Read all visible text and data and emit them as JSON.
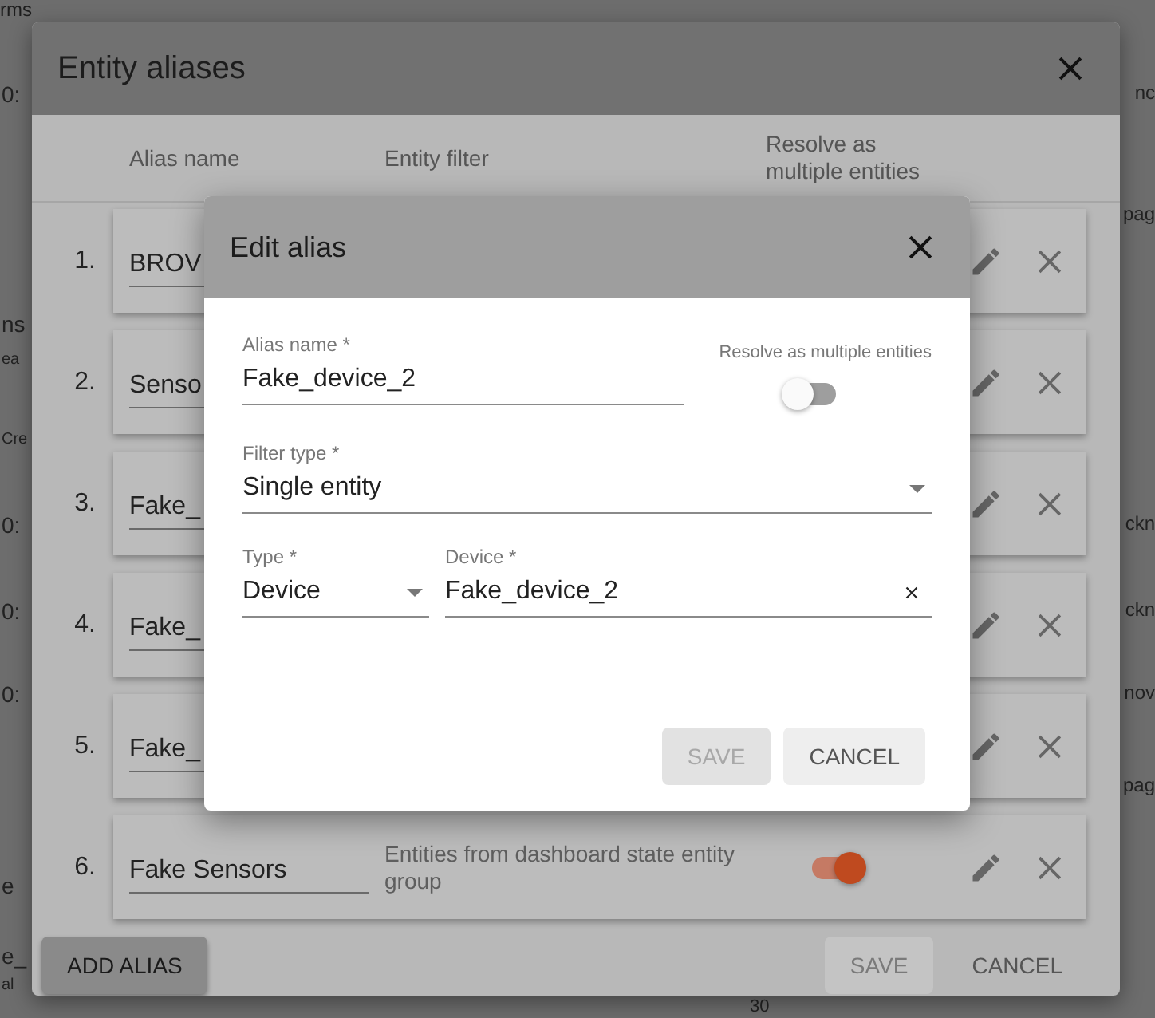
{
  "background": {
    "heading": "rms",
    "left_fragments": [
      "0:",
      "ns",
      "ea",
      "Cre",
      "0:",
      "0:",
      "0:",
      "e",
      "e_",
      "al"
    ],
    "right_fragments": [
      "nc",
      "pag",
      "ckn",
      "ckn",
      "nov",
      "pag"
    ],
    "bottom_fragment": "30"
  },
  "aliases_dialog": {
    "title": "Entity aliases",
    "columns": [
      "Alias name",
      "Entity filter",
      "Resolve as multiple entities"
    ],
    "aliases": [
      {
        "number": "1.",
        "name": "BROV"
      },
      {
        "number": "2.",
        "name": "Senso"
      },
      {
        "number": "3.",
        "name": "Fake_"
      },
      {
        "number": "4.",
        "name": "Fake_"
      },
      {
        "number": "5.",
        "name": "Fake_"
      },
      {
        "number": "6.",
        "name": "Fake Sensors",
        "filter": "Entities from dashboard state entity group",
        "resolve_multiple": true
      }
    ],
    "add_button": "ADD ALIAS",
    "save_button": {
      "label": "SAVE",
      "disabled": true
    },
    "cancel_button": {
      "label": "CANCEL",
      "disabled": false
    }
  },
  "edit_alias": {
    "title": "Edit alias",
    "alias_name": {
      "label": "Alias name *",
      "value": "Fake_device_2"
    },
    "resolve_label": "Resolve as multiple entities",
    "resolve_multiple": false,
    "filter_type": {
      "label": "Filter type *",
      "value": "Single entity"
    },
    "type": {
      "label": "Type *",
      "value": "Device"
    },
    "device": {
      "label": "Device *",
      "value": "Fake_device_2"
    },
    "save_button": {
      "label": "SAVE",
      "disabled": true
    },
    "cancel_button": {
      "label": "CANCEL",
      "disabled": false
    }
  }
}
